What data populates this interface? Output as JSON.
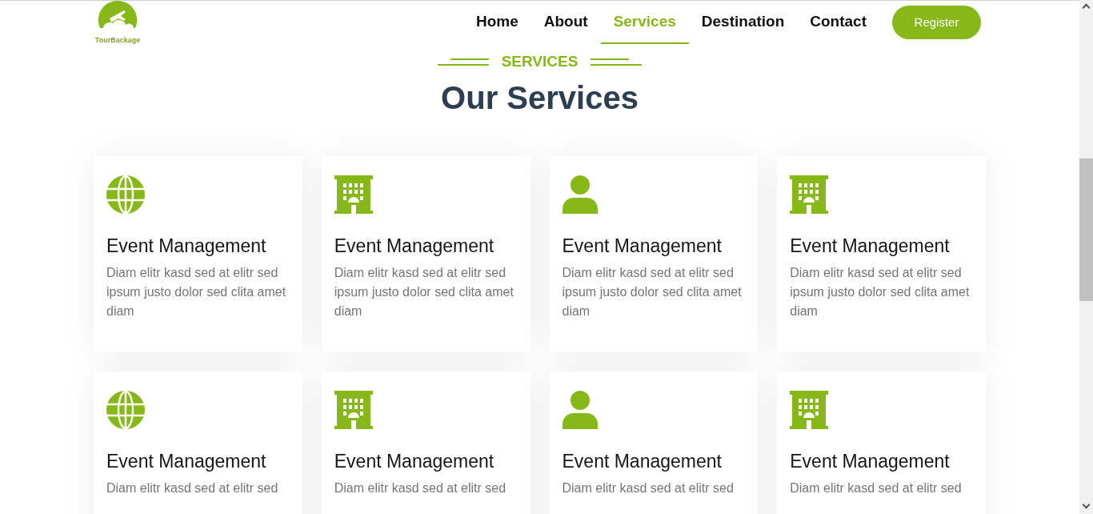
{
  "header": {
    "logo_text": "TourBackage",
    "nav": [
      {
        "label": "Home",
        "selected": false
      },
      {
        "label": "About",
        "selected": false
      },
      {
        "label": "Services",
        "selected": true
      },
      {
        "label": "Destination",
        "selected": false
      },
      {
        "label": "Contact",
        "selected": false
      }
    ],
    "register_button": "Register"
  },
  "section": {
    "eyebrow": "SERVICES",
    "title": "Our Services",
    "cards": [
      {
        "kind": "globe",
        "title": "Event Management",
        "text": "Diam elitr kasd sed at elitr sed ipsum justo dolor sed clita amet diam"
      },
      {
        "kind": "building",
        "title": "Event Management",
        "text": "Diam elitr kasd sed at elitr sed ipsum justo dolor sed clita amet diam"
      },
      {
        "kind": "person",
        "title": "Event Management",
        "text": "Diam elitr kasd sed at elitr sed ipsum justo dolor sed clita amet diam"
      },
      {
        "kind": "building",
        "title": "Event Management",
        "text": "Diam elitr kasd sed at elitr sed ipsum justo dolor sed clita amet diam"
      },
      {
        "kind": "globe",
        "title": "Event Management",
        "text": "Diam elitr kasd sed at elitr sed"
      },
      {
        "kind": "building",
        "title": "Event Management",
        "text": "Diam elitr kasd sed at elitr sed"
      },
      {
        "kind": "person",
        "title": "Event Management",
        "text": "Diam elitr kasd sed at elitr sed"
      },
      {
        "kind": "building",
        "title": "Event Management",
        "text": "Diam elitr kasd sed at elitr sed"
      }
    ]
  }
}
